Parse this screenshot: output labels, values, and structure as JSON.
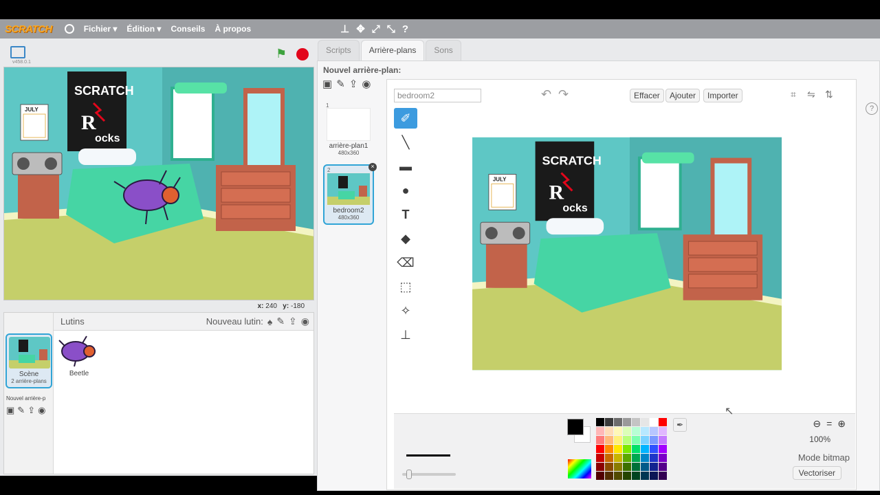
{
  "menubar": {
    "logo": "SCRATCH",
    "items": [
      "Fichier ▾",
      "Édition ▾",
      "Conseils",
      "À propos"
    ]
  },
  "stage": {
    "version": "v458.0.1",
    "coords_x_label": "x:",
    "coords_x": "240",
    "coords_y_label": "y:",
    "coords_y": "-180"
  },
  "sprites": {
    "header": "Lutins",
    "new_sprite": "Nouveau lutin:",
    "scene_label": "Scène",
    "scene_sub": "2 arrière-plans",
    "new_backdrop": "Nouvel arrière-p",
    "beetle_label": "Beetle"
  },
  "tabs": [
    "Scripts",
    "Arrière-plans",
    "Sons"
  ],
  "backdrops": {
    "title": "Nouvel arrière-plan:",
    "items": [
      {
        "num": "1",
        "name": "arrière-plan1",
        "size": "480x360"
      },
      {
        "num": "2",
        "name": "bedroom2",
        "size": "480x360"
      }
    ]
  },
  "editor": {
    "name_value": "bedroom2",
    "buttons": [
      "Effacer",
      "Ajouter",
      "Importer"
    ],
    "zoom": "100%",
    "mode": "Mode bitmap",
    "vectorize": "Vectoriser"
  },
  "palette": [
    "#000000",
    "#3a3a3a",
    "#6c6c6c",
    "#9a9a9a",
    "#c4c4c4",
    "#e6e6e6",
    "#ffffff",
    "#ff0000",
    "#ffb7b7",
    "#ffdcb7",
    "#fff8b7",
    "#dcffb7",
    "#b7ffd5",
    "#b7e8ff",
    "#b7c6ff",
    "#e0b7ff",
    "#ff7b7b",
    "#ffb97b",
    "#fff07b",
    "#b9ff7b",
    "#7bffb0",
    "#7bd2ff",
    "#7b9aff",
    "#c47bff",
    "#ff0000",
    "#ff8a00",
    "#ffe600",
    "#7ce800",
    "#00e06a",
    "#00b4ff",
    "#2e52ff",
    "#a200ff",
    "#c80000",
    "#c86a00",
    "#c8b400",
    "#5ca800",
    "#00a850",
    "#0086c8",
    "#1f36c8",
    "#7a00c8",
    "#8a0000",
    "#8a4a00",
    "#8a7c00",
    "#3c7000",
    "#007038",
    "#005a8a",
    "#142490",
    "#54008a",
    "#520000",
    "#522c00",
    "#524a00",
    "#244400",
    "#004420",
    "#003652",
    "#0c1656",
    "#320052"
  ]
}
